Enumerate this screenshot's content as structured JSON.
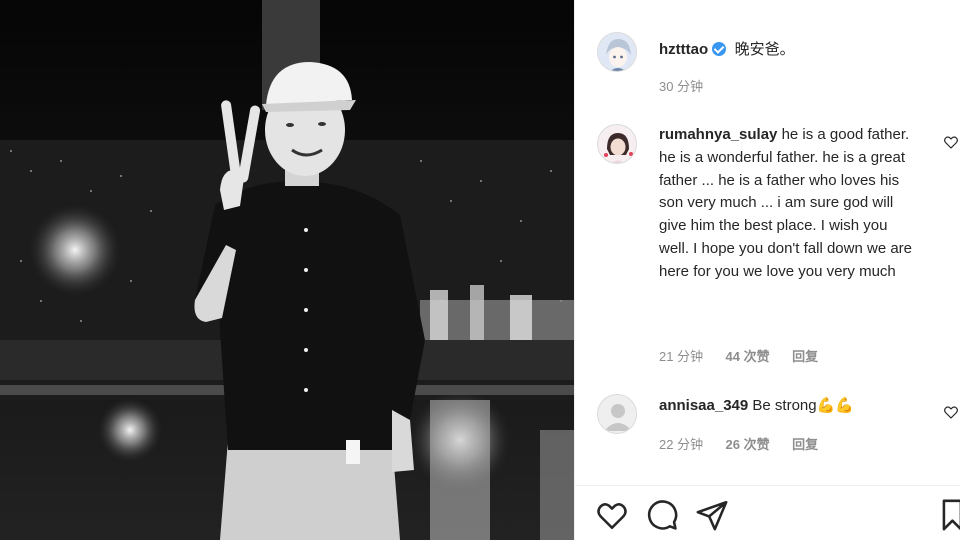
{
  "post": {
    "author": "hztttao",
    "caption": "晚安爸。",
    "time": "30 分钟",
    "verified": true
  },
  "comments": [
    {
      "username": "rumahnya_sulay",
      "text": "he is a good father. he is a wonderful father. he is a great father ... he is a father who loves his son very much ... i am sure god will give him the best place. I wish you well. I hope you don't fall down we are here for you we love you very much",
      "time": "21 分钟",
      "likes": "44 次赞",
      "reply": "回复"
    },
    {
      "username": "annisaa_349",
      "text": "Be strong",
      "emoji": "💪💪",
      "time": "22 分钟",
      "likes": "26 次赞",
      "reply": "回复"
    }
  ],
  "icons": {
    "like": "heart-icon",
    "comment": "comment-icon",
    "share": "send-icon",
    "save": "bookmark-icon",
    "verified": "verified-badge-icon"
  },
  "colors": {
    "verified": "#3897f0",
    "text": "#262626",
    "meta": "#8e8e8e",
    "photo_bg": "#0c0c0c"
  }
}
